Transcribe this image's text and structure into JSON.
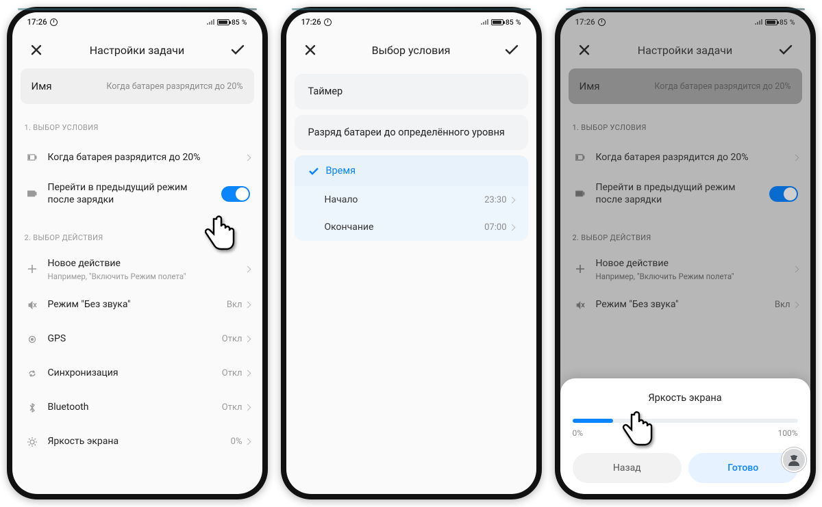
{
  "status": {
    "time": "17:26",
    "battery_pct": "85",
    "battery_unit": "%"
  },
  "s1": {
    "title": "Настройки задачи",
    "name_label": "Имя",
    "name_value": "Когда батарея разрядится до 20%",
    "sect1": "1. ВЫБОР УСЛОВИЯ",
    "cond": "Когда батарея разрядится до 20%",
    "revert": "Перейти в предыдущий режим после зарядки",
    "sect2": "2. ВЫБОР ДЕЙСТВИЯ",
    "new_action": "Новое действие",
    "new_action_sub": "Например, \"Включить Режим полета\"",
    "actions": [
      {
        "label": "Режим \"Без звука\"",
        "value": "Вкл",
        "icon": "mute"
      },
      {
        "label": "GPS",
        "value": "Откл",
        "icon": "gps"
      },
      {
        "label": "Синхронизация",
        "value": "Откл",
        "icon": "sync"
      },
      {
        "label": "Bluetooth",
        "value": "Откл",
        "icon": "bt"
      },
      {
        "label": "Яркость экрана",
        "value": "0%",
        "icon": "bright"
      }
    ]
  },
  "s2": {
    "title": "Выбор условия",
    "opt_timer": "Таймер",
    "opt_batt": "Разряд батареи до определённого уровня",
    "opt_time": "Время",
    "start_label": "Начало",
    "start_val": "23:30",
    "end_label": "Окончание",
    "end_val": "07:00"
  },
  "s3": {
    "sheet_title": "Яркость экрана",
    "min": "0%",
    "max": "100%",
    "cancel": "Назад",
    "ok": "Готово",
    "slider_value_pct": 18
  }
}
